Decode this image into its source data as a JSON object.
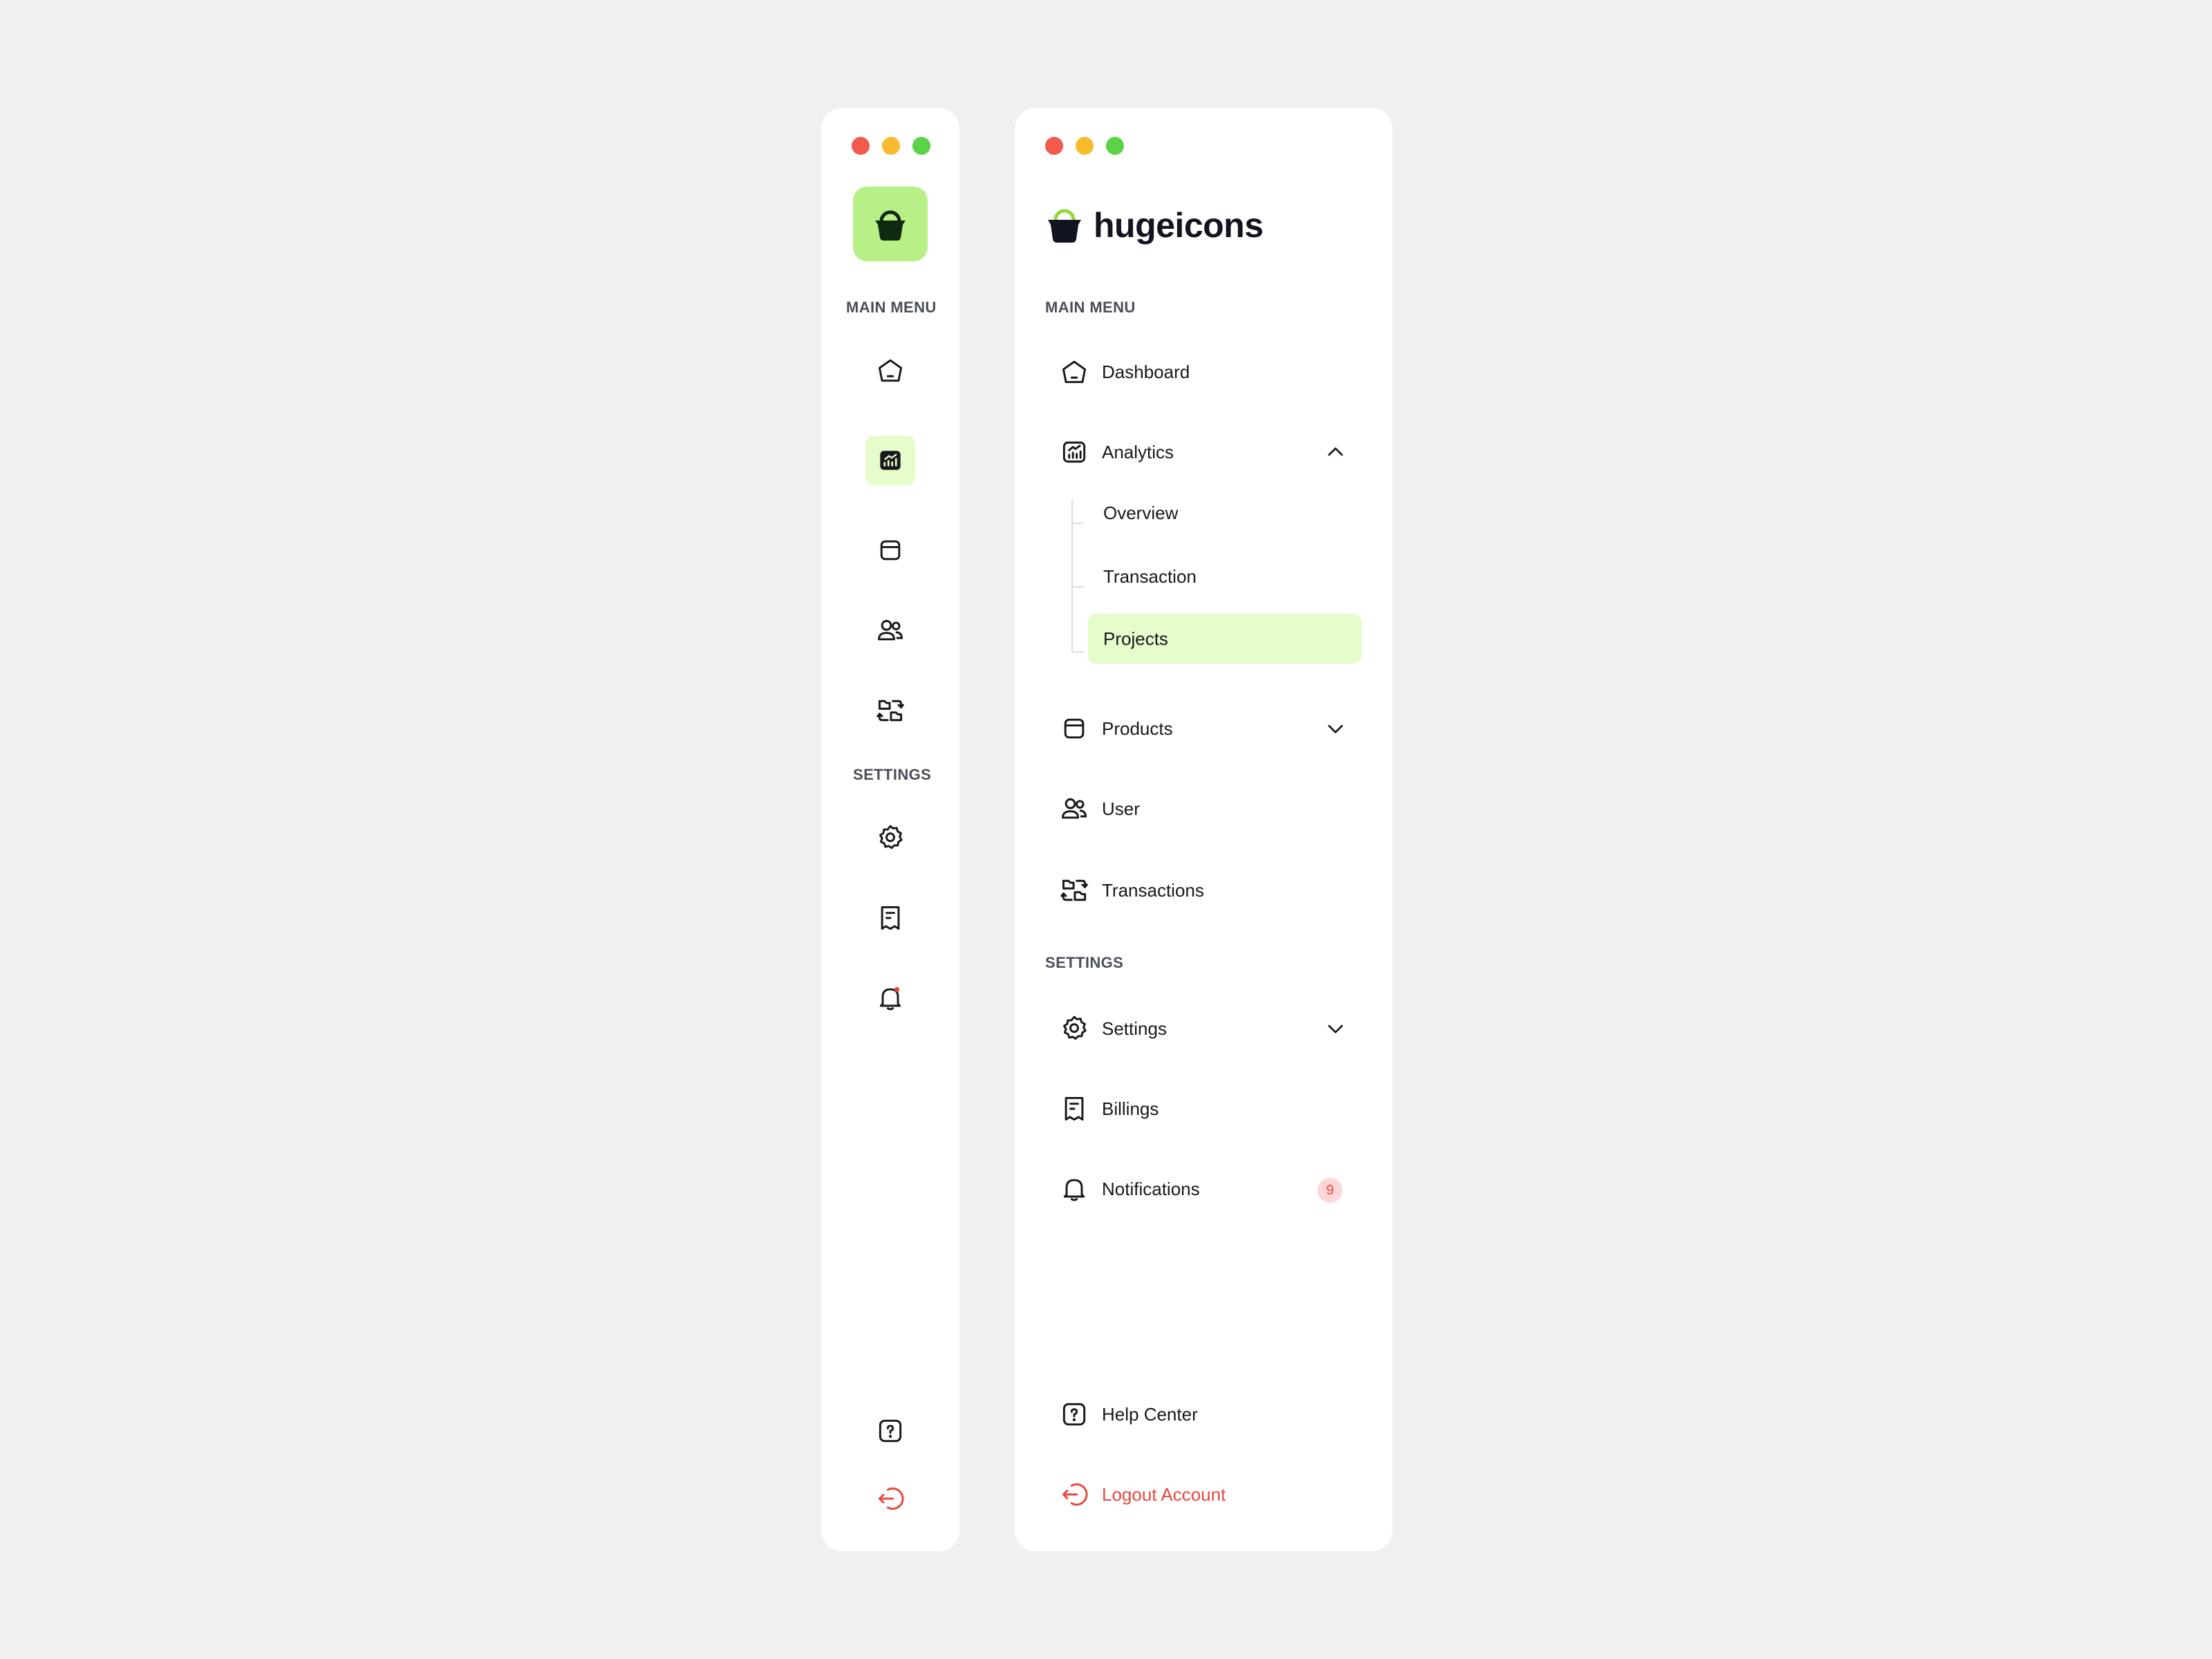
{
  "colors": {
    "accent": "#b8ef87",
    "accent_soft": "#e6fccb",
    "danger": "#e8473d",
    "window_red": "#f25a4c",
    "window_yellow": "#f8bb2e",
    "window_green": "#5ad346"
  },
  "brand": {
    "name": "hugeicons",
    "icon": "basket-icon"
  },
  "sections": {
    "main_menu": "Main Menu",
    "settings": "Settings"
  },
  "main_menu": [
    {
      "label": "Dashboard",
      "icon": "home-icon"
    },
    {
      "label": "Analytics",
      "icon": "analytics-icon",
      "expanded": true,
      "children": [
        "Overview",
        "Transaction",
        "Projects"
      ],
      "active_child": "Projects"
    },
    {
      "label": "Products",
      "icon": "package-icon",
      "expanded": false
    },
    {
      "label": "User",
      "icon": "users-icon"
    },
    {
      "label": "Transactions",
      "icon": "transfer-icon"
    }
  ],
  "settings_menu": [
    {
      "label": "Settings",
      "icon": "gear-icon",
      "expanded": false
    },
    {
      "label": "Billings",
      "icon": "receipt-icon"
    },
    {
      "label": "Notifications",
      "icon": "bell-icon",
      "badge": "9"
    }
  ],
  "footer": {
    "help": {
      "label": "Help Center",
      "icon": "help-icon"
    },
    "logout": {
      "label": "Logout Account",
      "icon": "logout-icon"
    }
  }
}
